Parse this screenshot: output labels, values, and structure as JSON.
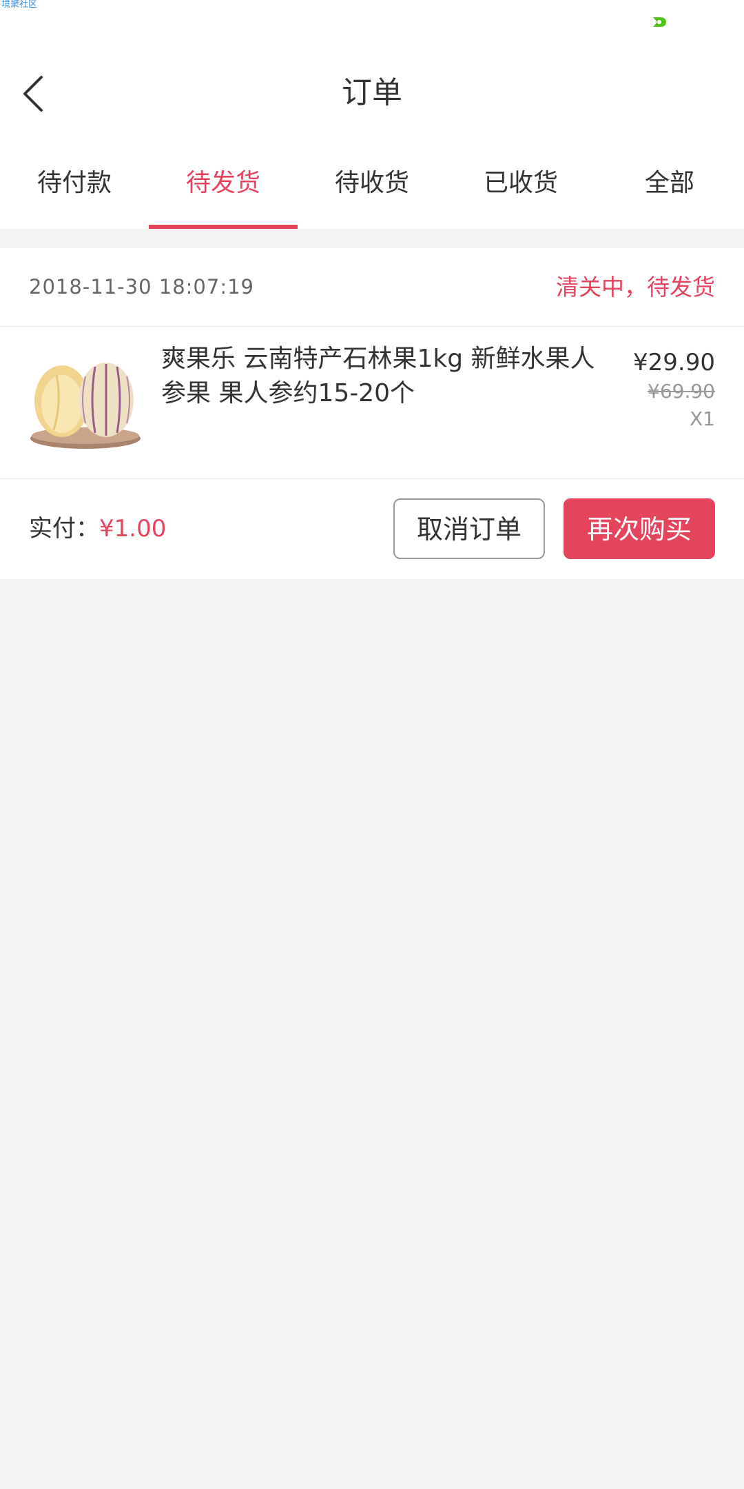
{
  "status_bar": {
    "watermark": "境聚社区",
    "indicator_color": "#52c41a"
  },
  "navbar": {
    "title": "订单",
    "back_icon": "chevron-left-icon"
  },
  "tabs": [
    {
      "label": "待付款",
      "active": false
    },
    {
      "label": "待发货",
      "active": true
    },
    {
      "label": "待收货",
      "active": false
    },
    {
      "label": "已收货",
      "active": false
    },
    {
      "label": "全部",
      "active": false
    }
  ],
  "order": {
    "time": "2018-11-30 18:07:19",
    "status": "清关中，待发货",
    "item": {
      "title": "爽果乐 云南特产石林果1kg 新鲜水果人参果 果人参约15-20个",
      "price": "¥29.90",
      "original_price": "¥69.90",
      "quantity": "X1"
    },
    "paid_label": "实付：",
    "paid_amount": "¥1.00",
    "actions": {
      "cancel_label": "取消订单",
      "rebuy_label": "再次购买"
    }
  },
  "colors": {
    "accent": "#e5445d",
    "background": "#f3f3f3",
    "text": "#333333",
    "muted": "#999999"
  }
}
